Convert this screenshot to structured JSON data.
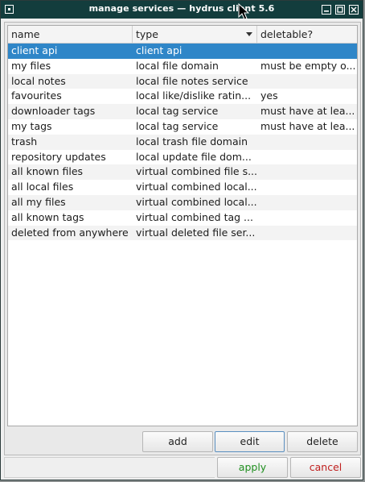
{
  "window": {
    "title": "manage services — hydrus client 5.6"
  },
  "list": {
    "headers": [
      "name",
      "type",
      "deletable?"
    ],
    "rows": [
      {
        "name": "client api",
        "type": "client api",
        "deletable": ""
      },
      {
        "name": "my files",
        "type": "local file domain",
        "deletable": "must be empty o..."
      },
      {
        "name": "local notes",
        "type": "local file notes service",
        "deletable": ""
      },
      {
        "name": "favourites",
        "type": "local like/dislike ratin...",
        "deletable": "yes"
      },
      {
        "name": "downloader tags",
        "type": "local tag service",
        "deletable": "must have at lea..."
      },
      {
        "name": "my tags",
        "type": "local tag service",
        "deletable": "must have at lea..."
      },
      {
        "name": "trash",
        "type": "local trash file domain",
        "deletable": ""
      },
      {
        "name": "repository updates",
        "type": "local update file dom...",
        "deletable": ""
      },
      {
        "name": "all known files",
        "type": "virtual combined file s...",
        "deletable": ""
      },
      {
        "name": "all local files",
        "type": "virtual combined local...",
        "deletable": ""
      },
      {
        "name": "all my files",
        "type": "virtual combined local...",
        "deletable": ""
      },
      {
        "name": "all known tags",
        "type": "virtual combined tag ...",
        "deletable": ""
      },
      {
        "name": "deleted from anywhere",
        "type": "virtual deleted file ser...",
        "deletable": ""
      }
    ],
    "selected_index": 0
  },
  "buttons": {
    "add": "add",
    "edit": "edit",
    "delete": "delete",
    "apply": "apply",
    "cancel": "cancel"
  },
  "colors": {
    "titlebar": "#133d3d",
    "selection": "#2f86c8",
    "apply_text": "#1f8f1f",
    "cancel_text": "#c0201f"
  },
  "icons": {
    "system_menu": "window-menu-icon",
    "minimize": "minimize-icon",
    "maximize": "maximize-icon",
    "close": "close-icon",
    "sort": "sort-descending-icon",
    "cursor": "mouse-pointer-icon"
  }
}
